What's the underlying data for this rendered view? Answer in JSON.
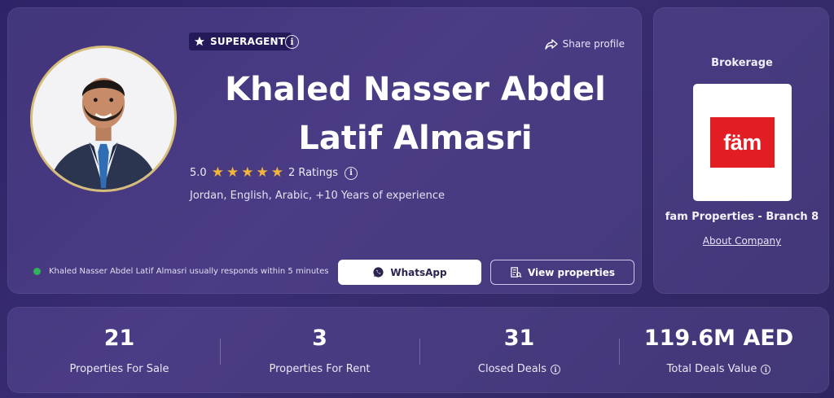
{
  "colors": {
    "background": "#2e2366",
    "card": "#4a3d86",
    "star": "#f4b43a",
    "online_dot": "#2fb35a",
    "brand_red": "#e31d24",
    "avatar_ring": "#d7bd7a"
  },
  "profile": {
    "badge": "SUPERAGENT",
    "badge_icon": "superagent-star-icon",
    "share_label": "Share profile",
    "name": "Khaled Nasser Abdel Latif Almasri",
    "rating_value": "5.0",
    "stars": 5,
    "ratings_label": "2 Ratings",
    "details": "Jordan, English, Arabic, +10 Years of experience",
    "response_text": "Khaled Nasser Abdel Latif Almasri usually responds within 5 minutes",
    "whatsapp_label": "WhatsApp",
    "view_properties_label": "View properties"
  },
  "brokerage": {
    "title": "Brokerage",
    "logo_text": "fäm",
    "name": "fam Properties - Branch 8",
    "about_label": "About Company"
  },
  "stats": [
    {
      "value": "21",
      "label": "Properties For Sale",
      "info": false
    },
    {
      "value": "3",
      "label": "Properties For Rent",
      "info": false
    },
    {
      "value": "31",
      "label": "Closed Deals",
      "info": true
    },
    {
      "value": "119.6M AED",
      "label": "Total Deals Value",
      "info": true
    }
  ]
}
